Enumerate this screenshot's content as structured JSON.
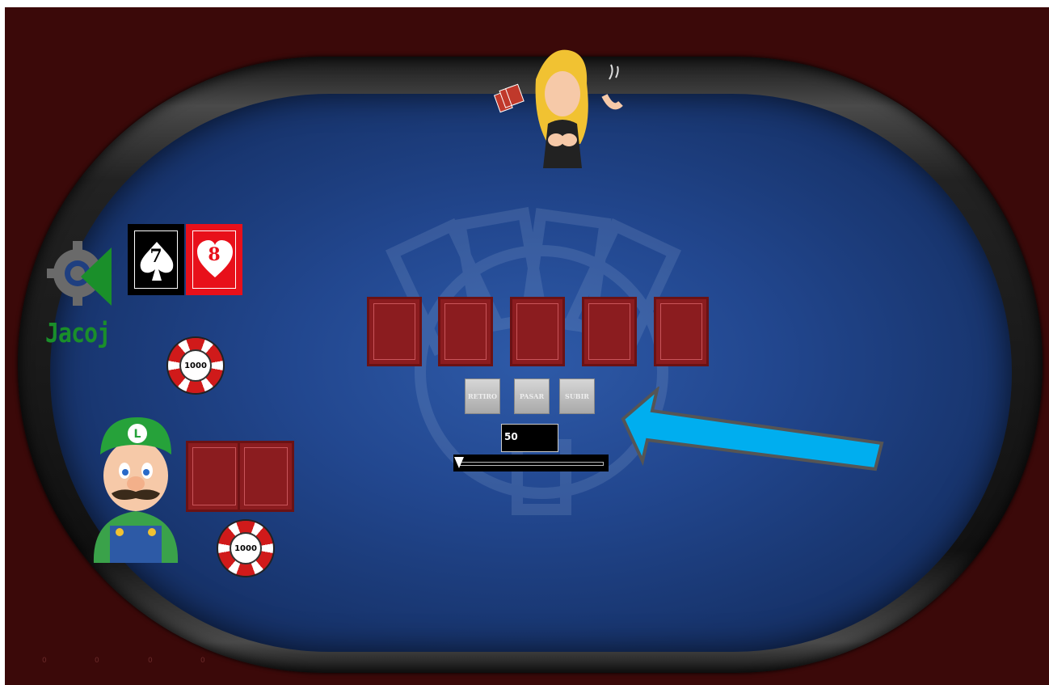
{
  "player": {
    "name": "Jacoj",
    "chip_value": "1000",
    "hole_cards": [
      {
        "rank": "7",
        "suit": "spades"
      },
      {
        "rank": "8",
        "suit": "hearts"
      }
    ]
  },
  "opponent": {
    "chip_value": "1000",
    "hole_cards": [
      "face-down",
      "face-down"
    ]
  },
  "community_cards": [
    "face-down",
    "face-down",
    "face-down",
    "face-down",
    "face-down"
  ],
  "actions": {
    "fold_label": "RETIRO",
    "check_label": "PASAR",
    "raise_label": "SUBIR"
  },
  "bet": {
    "amount": "50",
    "slider_fraction": 0.0
  },
  "footer_counters": [
    "0",
    "0",
    "0",
    "0"
  ],
  "colors": {
    "felt": "#22478f",
    "background": "#3b0909",
    "card_back": "#8b1c1f",
    "arrow": "#00aeef",
    "logo_green": "#1a8f2a"
  },
  "icons": [
    "gear-logo-icon",
    "back-arrow-icon",
    "pointer-arrow-icon",
    "dealer-avatar",
    "opponent-avatar"
  ]
}
